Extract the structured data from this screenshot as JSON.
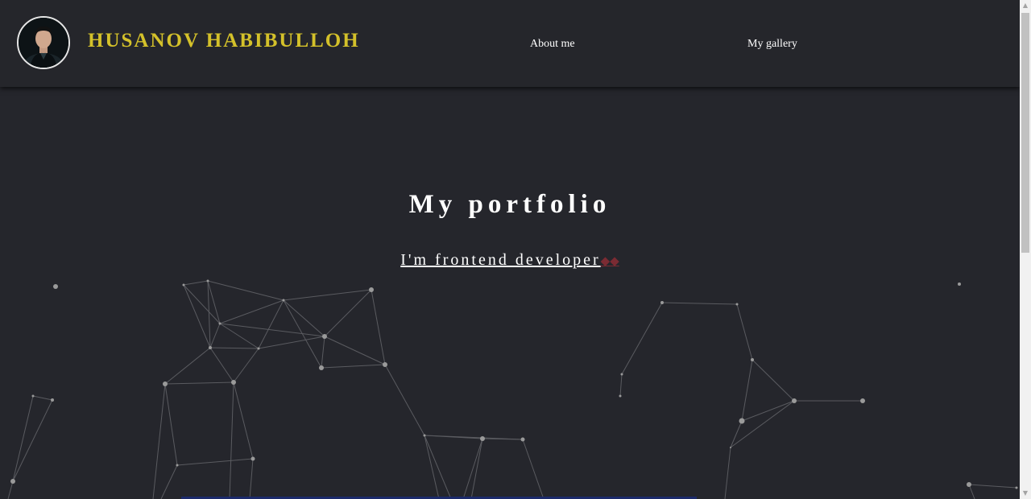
{
  "header": {
    "brand_name": "HUSANOV HABIBULLOH",
    "nav": [
      {
        "label": "About me"
      },
      {
        "label": "My gallery"
      }
    ]
  },
  "hero": {
    "title": "My portfolio",
    "subtitle": "I'm frontend developer",
    "cursor": "◆◆"
  },
  "colors": {
    "background": "#25262c",
    "brand": "#d4c12a",
    "text": "#ffffff",
    "network_nodes": "#9a9a9a",
    "network_lines": "#5a5b60"
  }
}
